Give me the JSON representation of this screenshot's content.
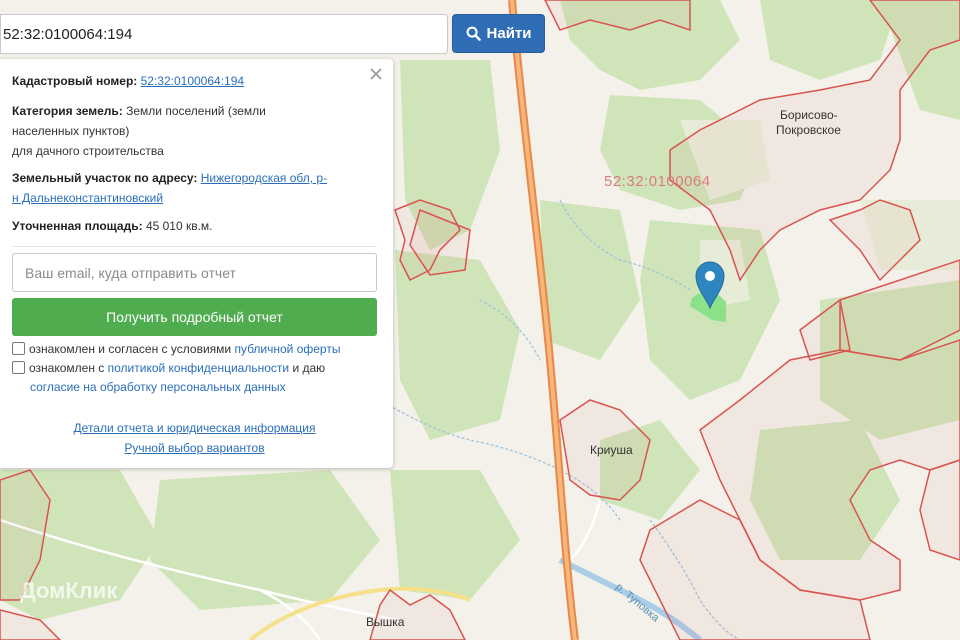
{
  "search": {
    "value": "52:32:0100064:194",
    "button_label": "Найти",
    "button_icon": "search-icon",
    "button_color": "#2f6db5"
  },
  "panel": {
    "close_icon": "close-icon",
    "cadastral_number_label": "Кадастровый номер:",
    "cadastral_number_value": "52:32:0100064:194",
    "category_label": "Категория земель:",
    "category_value_line1": "Земли поселений (земли",
    "category_value_line2": "населенных пунктов)",
    "category_value_line3": "для дачного строительства",
    "address_label": "Земельный участок по адресу:",
    "address_value_part1": "Нижегородская обл, р-",
    "address_value_part2": "н Дальнеконстантиновский",
    "area_label": "Уточненная площадь:",
    "area_value": "45 010 кв.м.",
    "email_placeholder": "Ваш email, куда отправить отчет",
    "report_button_label": "Получить подробный отчет",
    "report_button_color": "#4fad4f",
    "consent1_text": "ознакомлен и согласен с условиями ",
    "consent1_link": "публичной оферты",
    "consent2_text_a": "ознакомлен с ",
    "consent2_link_a": "политикой конфиденциальности",
    "consent2_text_b": " и даю",
    "consent2_link_b": "согласие на обработку персональных данных",
    "details_link": "Детали отчета и юридическая информация",
    "manual_link": "Ручной выбор вариантов"
  },
  "map": {
    "quarter_label": "52:32:0100064",
    "place_labels": {
      "borisovo_line1": "Борисово-",
      "borisovo_line2": "Покровское",
      "kriusha": "Криуша",
      "vyshka": "Вышка"
    },
    "river_label": "р. Туповка",
    "watermark": "ДомКлик",
    "marker_icon": "map-pin-icon",
    "marker_color": "#2e86c1",
    "parcel_color": "#7ee07e",
    "boundary_color": "#d9534f",
    "road_color": "#f0a35c"
  }
}
